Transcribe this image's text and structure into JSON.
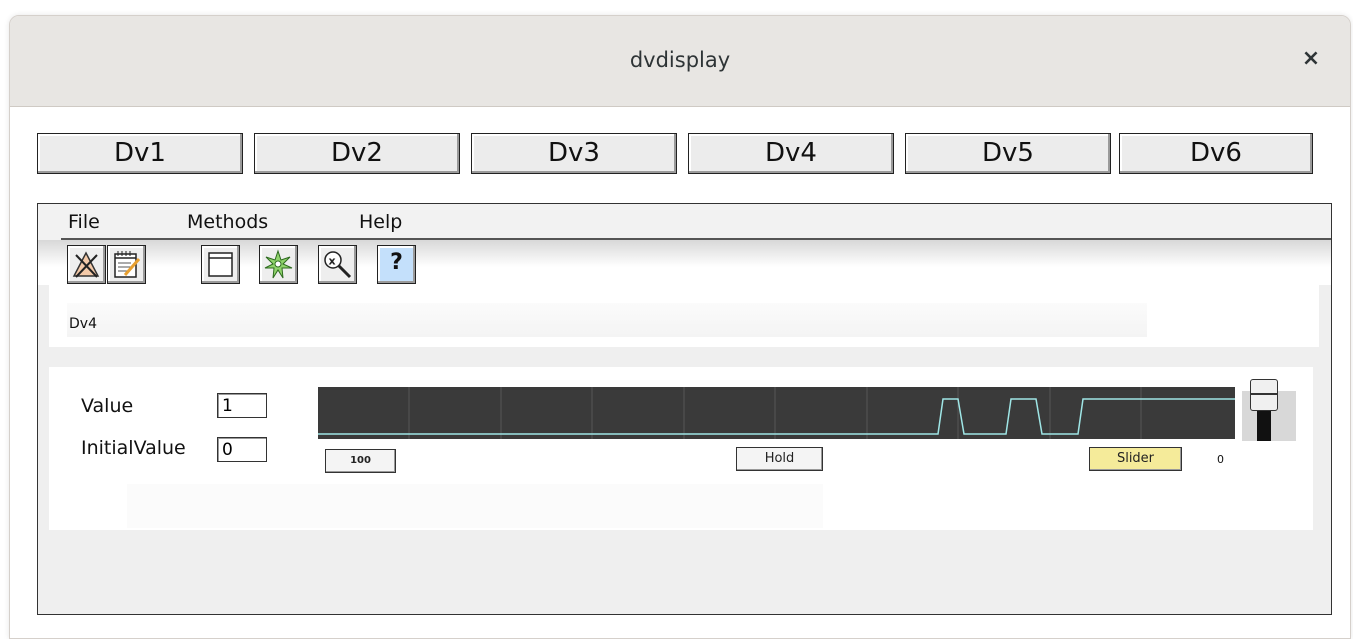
{
  "window": {
    "title": "dvdisplay",
    "close_label": "×"
  },
  "tabs": [
    {
      "label": "Dv1"
    },
    {
      "label": "Dv2"
    },
    {
      "label": "Dv3"
    },
    {
      "label": "Dv4"
    },
    {
      "label": "Dv5"
    },
    {
      "label": "Dv6"
    }
  ],
  "menu": {
    "file": "File",
    "methods": "Methods",
    "help": "Help"
  },
  "toolbar": {
    "icons": [
      "close-object-icon",
      "notepad-icon",
      "window-icon",
      "star-burst-icon",
      "magnifier-x-icon",
      "help-icon"
    ],
    "help_glyph": "?"
  },
  "object_name": "Dv4",
  "fields": {
    "value_label": "Value",
    "value": "1",
    "initial_label": "InitialValue",
    "initial_value": "0"
  },
  "trace": {
    "interval_label": "100",
    "hold_label": "Hold",
    "slider_label": "Slider",
    "slider_value": "0",
    "slider_button_color": "#f5eb9a"
  }
}
